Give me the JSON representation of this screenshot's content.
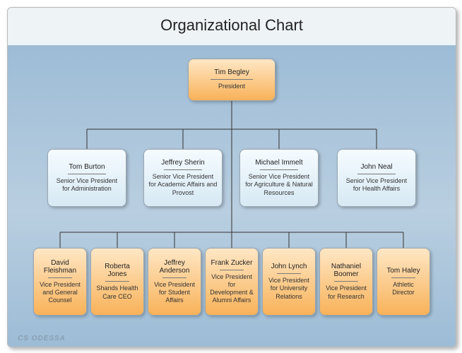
{
  "title": "Organizational Chart",
  "watermark": "CS ODESSA",
  "chart_data": {
    "type": "tree",
    "root": {
      "name": "Tim Begley",
      "role": "President",
      "style": "orange"
    },
    "level2": [
      {
        "name": "Tom Burton",
        "role": "Senior Vice President for Administration",
        "style": "blue"
      },
      {
        "name": "Jeffrey Sherin",
        "role": "Senior Vice President for Academic Affairs and Provost",
        "style": "blue"
      },
      {
        "name": "Michael Immelt",
        "role": "Senior Vice President for Agriculture & Natural Resources",
        "style": "blue"
      },
      {
        "name": "John Neal",
        "role": "Senior Vice President for Health Affairs",
        "style": "blue"
      }
    ],
    "level3": [
      {
        "name": "David Fleishman",
        "role": "Vice President and General Counsel",
        "style": "orange"
      },
      {
        "name": "Roberta Jones",
        "role": "Shands Health Care CEO",
        "style": "orange"
      },
      {
        "name": "Jeffrey Anderson",
        "role": "Vice President for Student Affairs",
        "style": "orange"
      },
      {
        "name": "Frank Zucker",
        "role": "Vice President for Development & Alumni Affairs",
        "style": "orange"
      },
      {
        "name": "John Lynch",
        "role": "Vice President for University Relations",
        "style": "orange"
      },
      {
        "name": "Nathaniel Boomer",
        "role": "Vice President for Research",
        "style": "orange"
      },
      {
        "name": "Tom Haley",
        "role": "Athletic Director",
        "style": "orange"
      }
    ]
  }
}
